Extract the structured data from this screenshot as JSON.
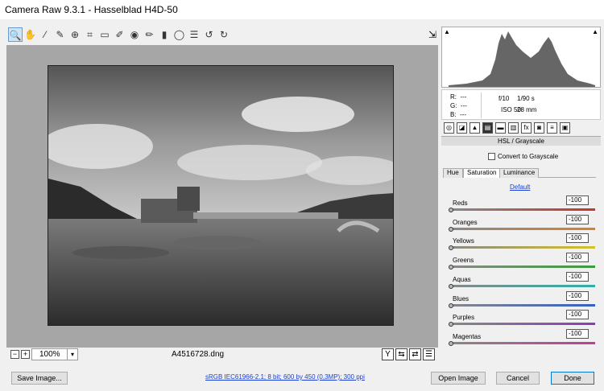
{
  "window": {
    "title": "Camera Raw 9.3.1  -  Hasselblad H4D-50"
  },
  "toolbar": {
    "tools": [
      {
        "name": "zoom-icon",
        "glyph": "🔍"
      },
      {
        "name": "hand-icon",
        "glyph": "✋"
      },
      {
        "name": "white-balance-icon",
        "glyph": "⁄"
      },
      {
        "name": "color-sampler-icon",
        "glyph": "✎"
      },
      {
        "name": "target-adjust-icon",
        "glyph": "⊕"
      },
      {
        "name": "crop-icon",
        "glyph": "⌗"
      },
      {
        "name": "straighten-icon",
        "glyph": "▭"
      },
      {
        "name": "spot-removal-icon",
        "glyph": "✐"
      },
      {
        "name": "red-eye-icon",
        "glyph": "◉"
      },
      {
        "name": "adjustment-brush-icon",
        "glyph": "✏"
      },
      {
        "name": "graduated-filter-icon",
        "glyph": "▮"
      },
      {
        "name": "radial-filter-icon",
        "glyph": "◯"
      },
      {
        "name": "preferences-icon",
        "glyph": "☰"
      },
      {
        "name": "rotate-ccw-icon",
        "glyph": "↺"
      },
      {
        "name": "rotate-cw-icon",
        "glyph": "↻"
      }
    ],
    "fullscreen_glyph": "⇲"
  },
  "status": {
    "zoom_minus": "−",
    "zoom_plus": "+",
    "zoom_value": "100%",
    "zoom_arrow": "▾",
    "filename": "A4516728.dng",
    "icons": [
      {
        "name": "before-after-icon",
        "glyph": "Y"
      },
      {
        "name": "toggle-settings-icon",
        "glyph": "⇆"
      },
      {
        "name": "swap-icon",
        "glyph": "⇄"
      },
      {
        "name": "preview-prefs-icon",
        "glyph": "☰"
      }
    ]
  },
  "info": {
    "r_label": "R:",
    "r_value": "---",
    "g_label": "G:",
    "g_value": "---",
    "b_label": "B:",
    "b_value": "---",
    "aperture": "f/10",
    "shutter": "1/90 s",
    "iso": "ISO 50",
    "focal": "28 mm"
  },
  "panel": {
    "tabs": [
      {
        "name": "basic-tab-icon",
        "glyph": "◎"
      },
      {
        "name": "tone-curve-tab-icon",
        "glyph": "◪"
      },
      {
        "name": "detail-tab-icon",
        "glyph": "▲"
      },
      {
        "name": "hsl-tab-icon",
        "glyph": "▤"
      },
      {
        "name": "split-toning-tab-icon",
        "glyph": "▬"
      },
      {
        "name": "lens-corrections-tab-icon",
        "glyph": "▥"
      },
      {
        "name": "effects-tab-icon",
        "glyph": "fx"
      },
      {
        "name": "camera-calibration-tab-icon",
        "glyph": "◙"
      },
      {
        "name": "presets-tab-icon",
        "glyph": "≡"
      },
      {
        "name": "snapshots-tab-icon",
        "glyph": "▣"
      }
    ],
    "heading": "HSL / Grayscale",
    "convert_label": "Convert to Grayscale",
    "subtabs": [
      "Hue",
      "Saturation",
      "Luminance"
    ],
    "default_link": "Default",
    "sliders": [
      {
        "label": "Reds",
        "value": "-100",
        "color": "#c0392b"
      },
      {
        "label": "Oranges",
        "value": "-100",
        "color": "#d9822b"
      },
      {
        "label": "Yellows",
        "value": "-100",
        "color": "#d4c22a"
      },
      {
        "label": "Greens",
        "value": "-100",
        "color": "#3e9c3e"
      },
      {
        "label": "Aquas",
        "value": "-100",
        "color": "#2fb0a8"
      },
      {
        "label": "Blues",
        "value": "-100",
        "color": "#3560c4"
      },
      {
        "label": "Purples",
        "value": "-100",
        "color": "#8a3bb8"
      },
      {
        "label": "Magentas",
        "value": "-100",
        "color": "#c43b9c"
      }
    ]
  },
  "footer": {
    "save_label": "Save Image...",
    "workflow_link": "sRGB IEC61966-2.1; 8 bit; 600 by 450 (0,3MP); 300 ppi",
    "open_label": "Open Image",
    "cancel_label": "Cancel",
    "done_label": "Done"
  }
}
